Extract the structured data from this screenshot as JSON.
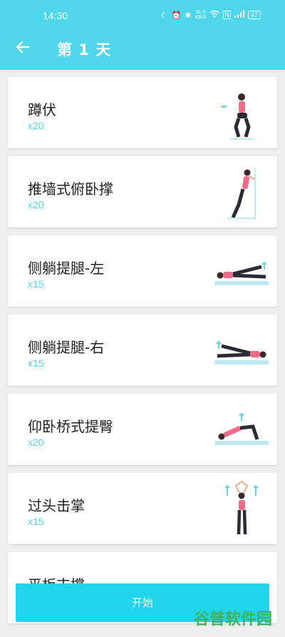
{
  "status": {
    "time": "14:30",
    "speed": "31.0\nKB/S",
    "battery": "47"
  },
  "toolbar": {
    "title": "第 1 天"
  },
  "exercises": [
    {
      "name": "蹲伏",
      "reps": "x20",
      "icon": "squat-illustration"
    },
    {
      "name": "推墙式俯卧撑",
      "reps": "x20",
      "icon": "wall-pushup-illustration"
    },
    {
      "name": "侧躺提腿-左",
      "reps": "x15",
      "icon": "side-leg-raise-left-illustration"
    },
    {
      "name": "侧躺提腿-右",
      "reps": "x15",
      "icon": "side-leg-raise-right-illustration"
    },
    {
      "name": "仰卧桥式提臀",
      "reps": "x20",
      "icon": "glute-bridge-illustration"
    },
    {
      "name": "过头击掌",
      "reps": "x15",
      "icon": "overhead-clap-illustration"
    },
    {
      "name": "平板支撑",
      "reps": "",
      "icon": ""
    }
  ],
  "start_button": {
    "label": "开始"
  },
  "watermark": "谷普软件园",
  "colors": {
    "accent": "#4fd6ea",
    "button": "#21d4ec",
    "pink": "#ef6b86"
  }
}
